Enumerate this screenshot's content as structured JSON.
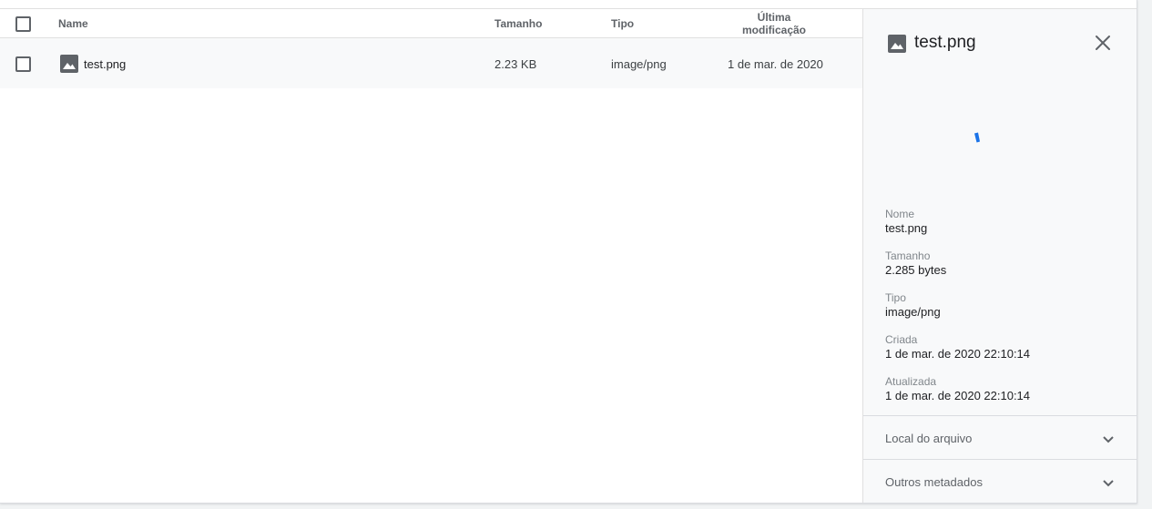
{
  "file_list": {
    "columns": {
      "name": "Name",
      "size": "Tamanho",
      "type": "Tipo",
      "modified": "Última modificação"
    },
    "rows": [
      {
        "name": "test.png",
        "size": "2.23 KB",
        "type": "image/png",
        "modified": "1 de mar. de 2020",
        "icon": "image-icon"
      }
    ]
  },
  "details": {
    "title": "test.png",
    "icon": "image-icon",
    "close_icon": "close-icon",
    "fields": [
      {
        "label": "Nome",
        "value": "test.png"
      },
      {
        "label": "Tamanho",
        "value": "2.285 bytes"
      },
      {
        "label": "Tipo",
        "value": "image/png"
      },
      {
        "label": "Criada",
        "value": "1 de mar. de 2020 22:10:14"
      },
      {
        "label": "Atualizada",
        "value": "1 de mar. de 2020 22:10:14"
      }
    ],
    "sections": [
      {
        "label": "Local do arquivo",
        "icon": "chevron-down-icon"
      },
      {
        "label": "Outros metadados",
        "icon": "chevron-down-icon"
      }
    ]
  },
  "colors": {
    "accent": "#1a73e8",
    "icon_gray": "#5f6368",
    "panel_bg": "#f8f9fa"
  }
}
